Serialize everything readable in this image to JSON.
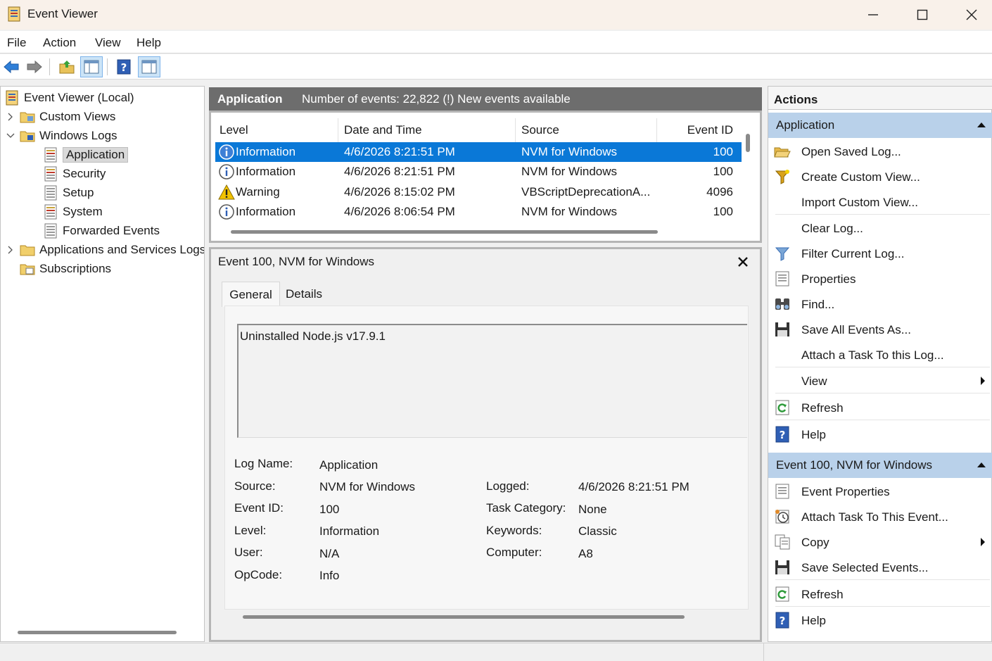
{
  "window": {
    "title": "Event Viewer",
    "icons": {
      "app": "event-viewer-icon",
      "minimize": "minimize-icon",
      "maximize": "maximize-icon",
      "close": "close-icon"
    }
  },
  "menu": {
    "items": [
      "File",
      "Action",
      "View",
      "Help"
    ]
  },
  "toolbar": {
    "buttons": [
      "back-arrow-icon",
      "forward-arrow-icon",
      "up-folder-icon",
      "show-hide-tree-icon",
      "help-icon",
      "show-hide-action-pane-icon"
    ]
  },
  "tree": {
    "items": [
      {
        "label": "Event Viewer (Local)",
        "icon": "event-viewer-icon"
      },
      {
        "label": "Custom Views",
        "icon": "folder-icon"
      },
      {
        "label": "Windows Logs",
        "icon": "folder-icon"
      },
      {
        "label": "Application",
        "icon": "log-icon",
        "selected": true
      },
      {
        "label": "Security",
        "icon": "log-icon"
      },
      {
        "label": "Setup",
        "icon": "log-icon"
      },
      {
        "label": "System",
        "icon": "log-icon"
      },
      {
        "label": "Forwarded Events",
        "icon": "log-icon"
      },
      {
        "label": "Applications and Services Logs",
        "icon": "folder-icon"
      },
      {
        "label": "Subscriptions",
        "icon": "subscriptions-icon"
      }
    ]
  },
  "log_header": {
    "name": "Application",
    "info": "Number of events: 22,822 (!) New events available"
  },
  "event_table": {
    "columns": [
      "Level",
      "Date and Time",
      "Source",
      "Event ID"
    ],
    "rows": [
      {
        "level": "Information",
        "icon": "information-icon",
        "datetime": "4/6/2026 8:21:51 PM",
        "source": "NVM for Windows",
        "event_id": "100",
        "selected": true
      },
      {
        "level": "Information",
        "icon": "information-icon",
        "datetime": "4/6/2026 8:21:51 PM",
        "source": "NVM for Windows",
        "event_id": "100"
      },
      {
        "level": "Warning",
        "icon": "warning-icon",
        "datetime": "4/6/2026 8:15:02 PM",
        "source": "VBScriptDeprecationA...",
        "event_id": "4096"
      },
      {
        "level": "Information",
        "icon": "information-icon",
        "datetime": "4/6/2026 8:06:54 PM",
        "source": "NVM for Windows",
        "event_id": "100"
      }
    ]
  },
  "detail": {
    "title": "Event 100, NVM for Windows",
    "tabs": [
      "General",
      "Details"
    ],
    "message": "Uninstalled Node.js v17.9.1",
    "fields": {
      "log_name_label": "Log Name:",
      "log_name": "Application",
      "source_label": "Source:",
      "source": "NVM for Windows",
      "logged_label": "Logged:",
      "logged": "4/6/2026 8:21:51 PM",
      "event_id_label": "Event ID:",
      "event_id": "100",
      "task_category_label": "Task Category:",
      "task_category": "None",
      "level_label": "Level:",
      "level": "Information",
      "keywords_label": "Keywords:",
      "keywords": "Classic",
      "user_label": "User:",
      "user": "N/A",
      "computer_label": "Computer:",
      "computer": "A8",
      "opcode_label": "OpCode:",
      "opcode": "Info"
    }
  },
  "actions": {
    "title": "Actions",
    "sections": [
      {
        "title": "Application",
        "items": [
          {
            "label": "Open Saved Log...",
            "icon": "open-folder-icon"
          },
          {
            "label": "Create Custom View...",
            "icon": "funnel-star-icon"
          },
          {
            "label": "Import Custom View...",
            "icon": ""
          },
          {
            "label": "Clear Log...",
            "icon": ""
          },
          {
            "label": "Filter Current Log...",
            "icon": "funnel-icon"
          },
          {
            "label": "Properties",
            "icon": "properties-icon"
          },
          {
            "label": "Find...",
            "icon": "binoculars-icon"
          },
          {
            "label": "Save All Events As...",
            "icon": "floppy-icon"
          },
          {
            "label": "Attach a Task To this Log...",
            "icon": ""
          },
          {
            "label": "View",
            "icon": "",
            "submenu": true
          },
          {
            "label": "Refresh",
            "icon": "refresh-icon"
          },
          {
            "label": "Help",
            "icon": "help-icon"
          }
        ]
      },
      {
        "title": "Event 100, NVM for Windows",
        "items": [
          {
            "label": "Event Properties",
            "icon": "properties-icon"
          },
          {
            "label": "Attach Task To This Event...",
            "icon": "clock-task-icon"
          },
          {
            "label": "Copy",
            "icon": "copy-icon",
            "submenu": true
          },
          {
            "label": "Save Selected Events...",
            "icon": "floppy-icon"
          },
          {
            "label": "Refresh",
            "icon": "refresh-icon"
          },
          {
            "label": "Help",
            "icon": "help-icon"
          }
        ]
      }
    ]
  },
  "colors": {
    "selection": "#0a78d7",
    "section_header": "#b9d1ea",
    "pane_header": "#6d6d6d"
  }
}
